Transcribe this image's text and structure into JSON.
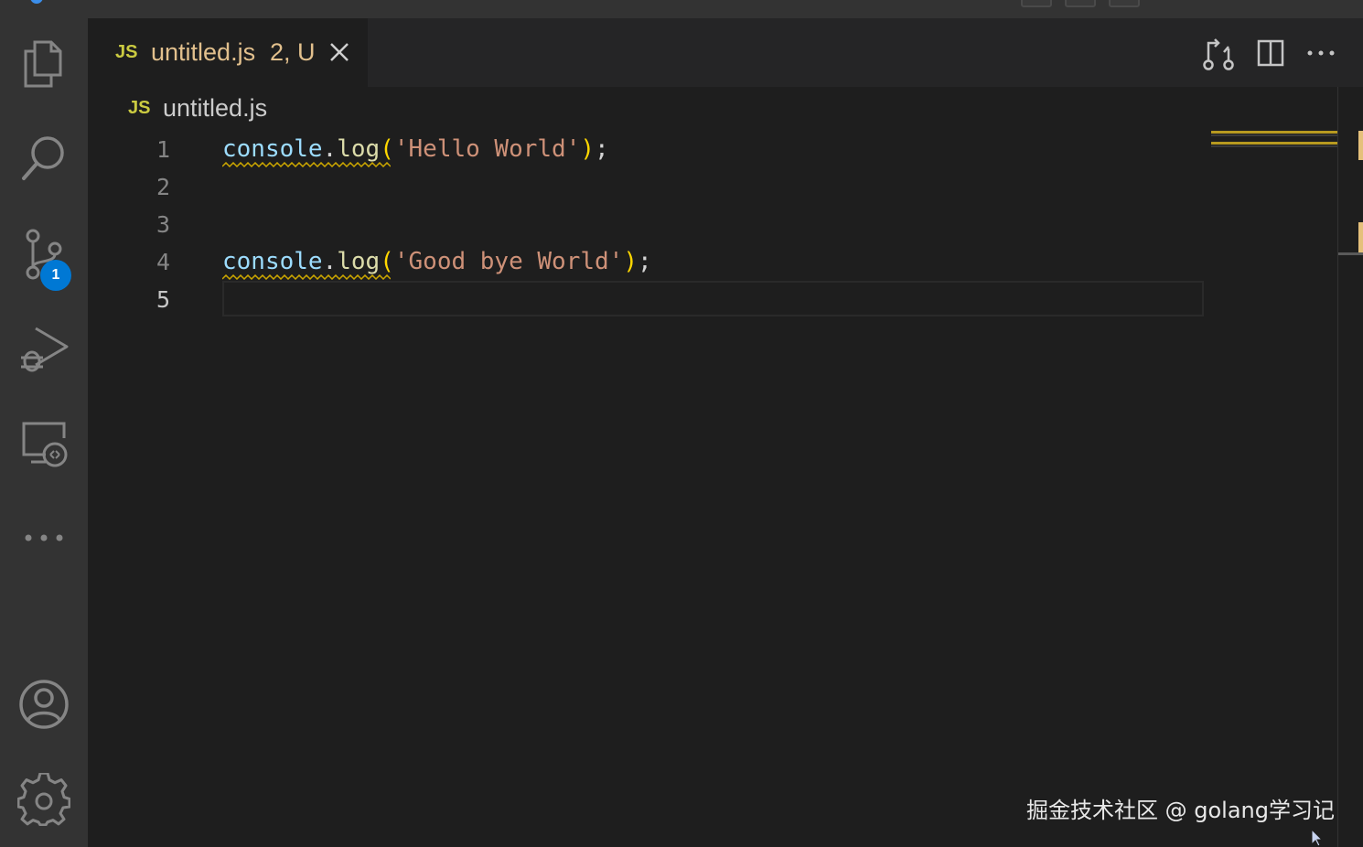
{
  "activity_bar": {
    "items": [
      {
        "name": "explorer",
        "icon": "files-icon"
      },
      {
        "name": "search",
        "icon": "search-icon"
      },
      {
        "name": "source-control",
        "icon": "source-control-icon",
        "badge": "1"
      },
      {
        "name": "run-and-debug",
        "icon": "run-debug-icon"
      },
      {
        "name": "remote-explorer",
        "icon": "remote-explorer-icon"
      },
      {
        "name": "more",
        "icon": "more-icon"
      }
    ],
    "bottom_items": [
      {
        "name": "accounts",
        "icon": "account-icon"
      },
      {
        "name": "manage",
        "icon": "gear-icon"
      }
    ]
  },
  "tab": {
    "lang_badge": "JS",
    "filename": "untitled.js",
    "status": "2, U",
    "close_icon": "close-icon"
  },
  "editor_actions": [
    "open-changes-icon",
    "split-editor-icon",
    "more-actions-icon"
  ],
  "breadcrumb": {
    "lang_badge": "JS",
    "file": "untitled.js"
  },
  "editor": {
    "line_numbers": [
      "1",
      "2",
      "3",
      "4",
      "5"
    ],
    "active_line": "5",
    "lines": [
      {
        "var": "console",
        "dot": ".",
        "fn": "log",
        "open": "(",
        "str": "'Hello World'",
        "close": ")",
        "end": ";"
      },
      {
        "var": "console",
        "dot": ".",
        "fn": "log",
        "open": "(",
        "str": "'Good bye World'",
        "close": ")",
        "end": ";"
      }
    ]
  },
  "colors": {
    "warning": "#cca700",
    "modified": "#e2c08d",
    "badge": "#0078d4",
    "background": "#1e1e1e"
  },
  "watermark": "掘金技术社区 @ golang学习记"
}
